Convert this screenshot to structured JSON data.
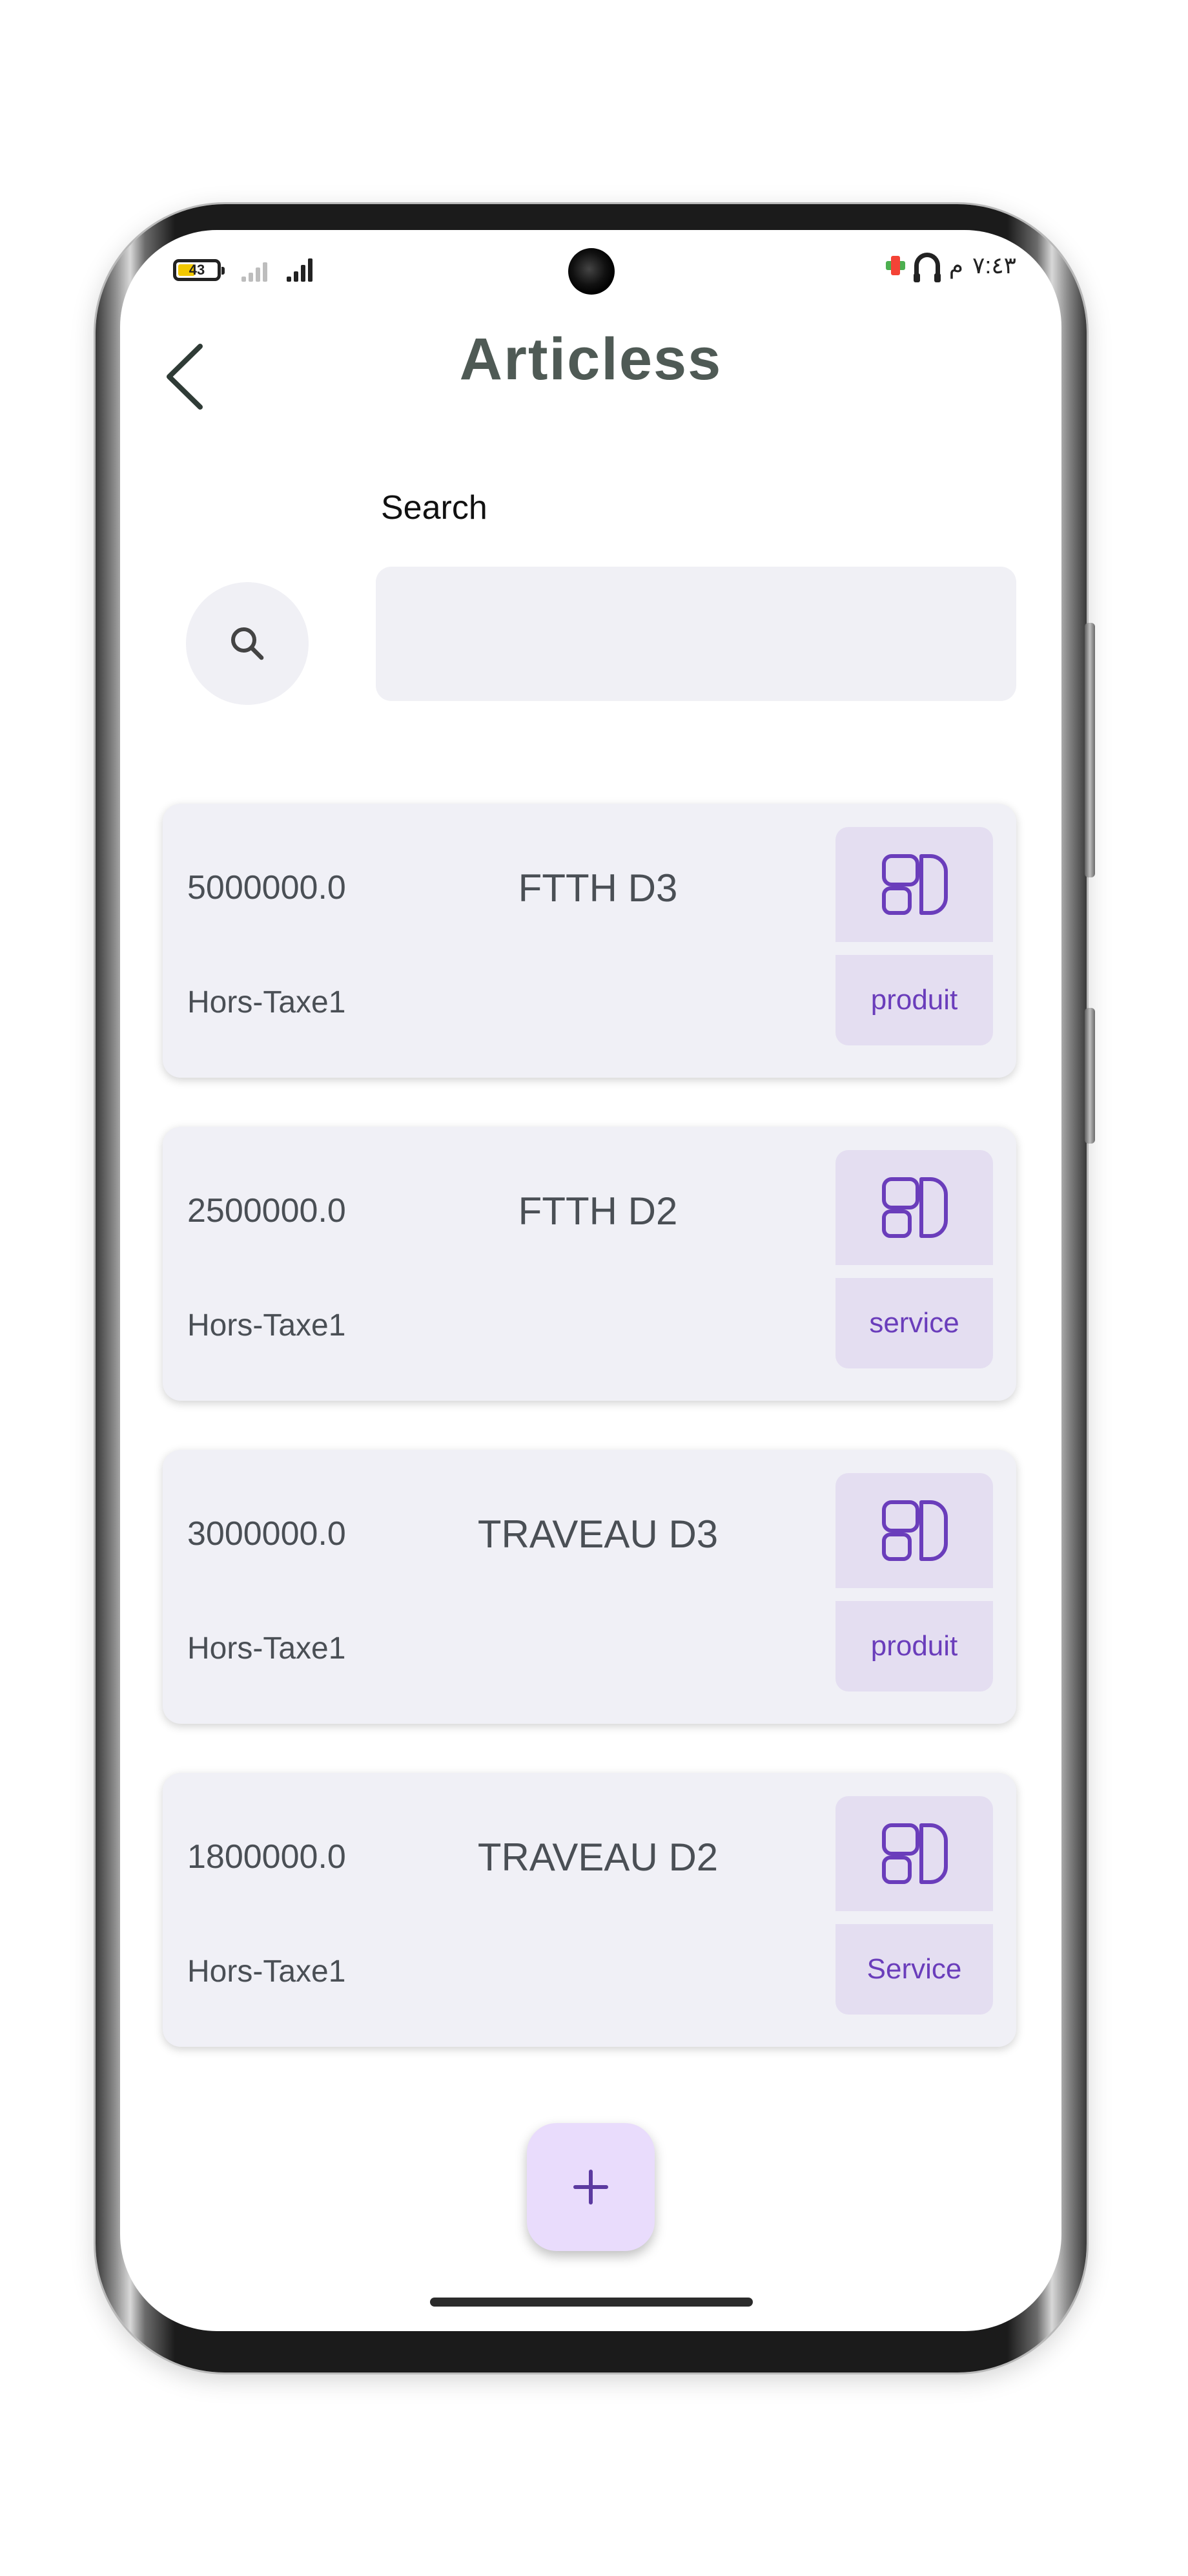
{
  "status_bar": {
    "battery_level": "43",
    "time": "٧:٤٣",
    "period": "م",
    "battery_color": "#f2c800"
  },
  "header": {
    "title": "Articless",
    "back_icon": "chevron-left-icon"
  },
  "search": {
    "label": "Search",
    "placeholder": "",
    "value": "",
    "icon": "search-icon"
  },
  "articles": [
    {
      "price": "5000000.0",
      "name": "FTTH D3",
      "tax": "Hors-Taxe1",
      "type": "produit",
      "icon": "widgets-icon"
    },
    {
      "price": "2500000.0",
      "name": "FTTH D2",
      "tax": "Hors-Taxe1",
      "type": "service",
      "icon": "widgets-icon"
    },
    {
      "price": "3000000.0",
      "name": "TRAVEAU D3",
      "tax": "Hors-Taxe1",
      "type": "produit",
      "icon": "widgets-icon"
    },
    {
      "price": "1800000.0",
      "name": "TRAVEAU D2",
      "tax": "Hors-Taxe1",
      "type": "Service",
      "icon": "widgets-icon"
    }
  ],
  "fab": {
    "icon": "plus-icon",
    "label": "+"
  },
  "colors": {
    "title": "#4f5a55",
    "card_bg": "#f0f0f6",
    "badge_bg": "#e4def1",
    "accent": "#6a3dbb",
    "fab_bg": "#e9dcfc"
  }
}
